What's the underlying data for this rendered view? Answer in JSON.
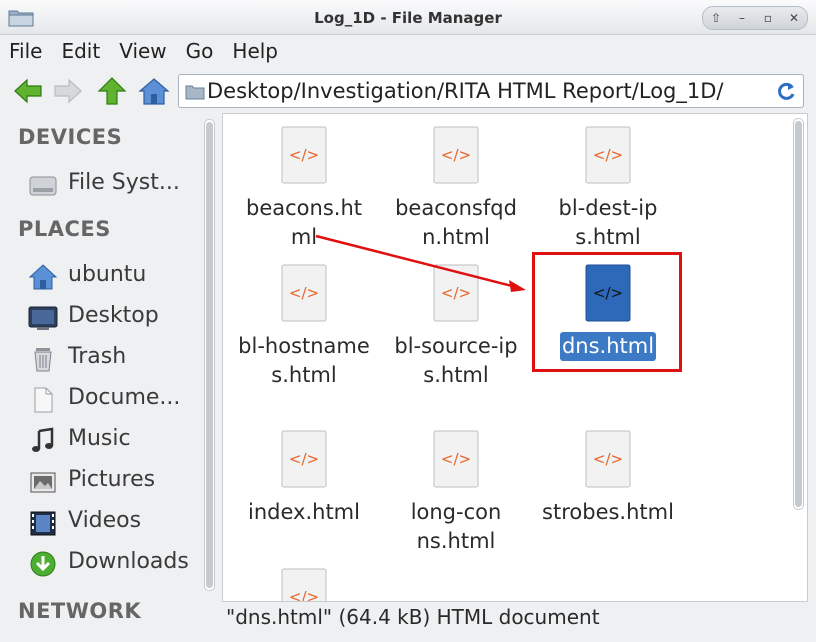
{
  "window": {
    "title": "Log_1D - File Manager",
    "controls": [
      "⇧",
      "–",
      "▫",
      "✕"
    ]
  },
  "menu": [
    "File",
    "Edit",
    "View",
    "Go",
    "Help"
  ],
  "toolbar": {
    "back": "back-icon",
    "forward": "forward-icon",
    "up": "up-icon",
    "home": "home-icon",
    "path": "Desktop/Investigation/RITA HTML Report/Log_1D/"
  },
  "sidebar": {
    "devices_heading": "DEVICES",
    "devices": [
      {
        "label": "File Syst...",
        "icon": "drive-icon"
      }
    ],
    "places_heading": "PLACES",
    "places": [
      {
        "label": "ubuntu",
        "icon": "home-folder-icon"
      },
      {
        "label": "Desktop",
        "icon": "desktop-icon"
      },
      {
        "label": "Trash",
        "icon": "trash-icon"
      },
      {
        "label": "Docume...",
        "icon": "document-icon"
      },
      {
        "label": "Music",
        "icon": "music-icon"
      },
      {
        "label": "Pictures",
        "icon": "pictures-icon"
      },
      {
        "label": "Videos",
        "icon": "videos-icon"
      },
      {
        "label": "Downloads",
        "icon": "downloads-icon"
      }
    ],
    "network_heading": "NETWORK"
  },
  "files": [
    {
      "name": "beacons.html",
      "selected": false
    },
    {
      "name": "beaconsfqdn.html",
      "selected": false
    },
    {
      "name": "bl-dest-ips.html",
      "selected": false
    },
    {
      "name": "bl-hostnames.html",
      "selected": false
    },
    {
      "name": "bl-source-ips.html",
      "selected": false
    },
    {
      "name": "dns.html",
      "selected": true
    },
    {
      "name": "index.html",
      "selected": false
    },
    {
      "name": "long-conns.html",
      "selected": false
    },
    {
      "name": "strobes.html",
      "selected": false
    }
  ],
  "file_icon_glyph": "</>",
  "status": "\"dns.html\" (64.4 kB) HTML document",
  "colors": {
    "selection": "#3d7ac6",
    "annotation": "#e01010",
    "html_glyph": "#e8632a"
  }
}
